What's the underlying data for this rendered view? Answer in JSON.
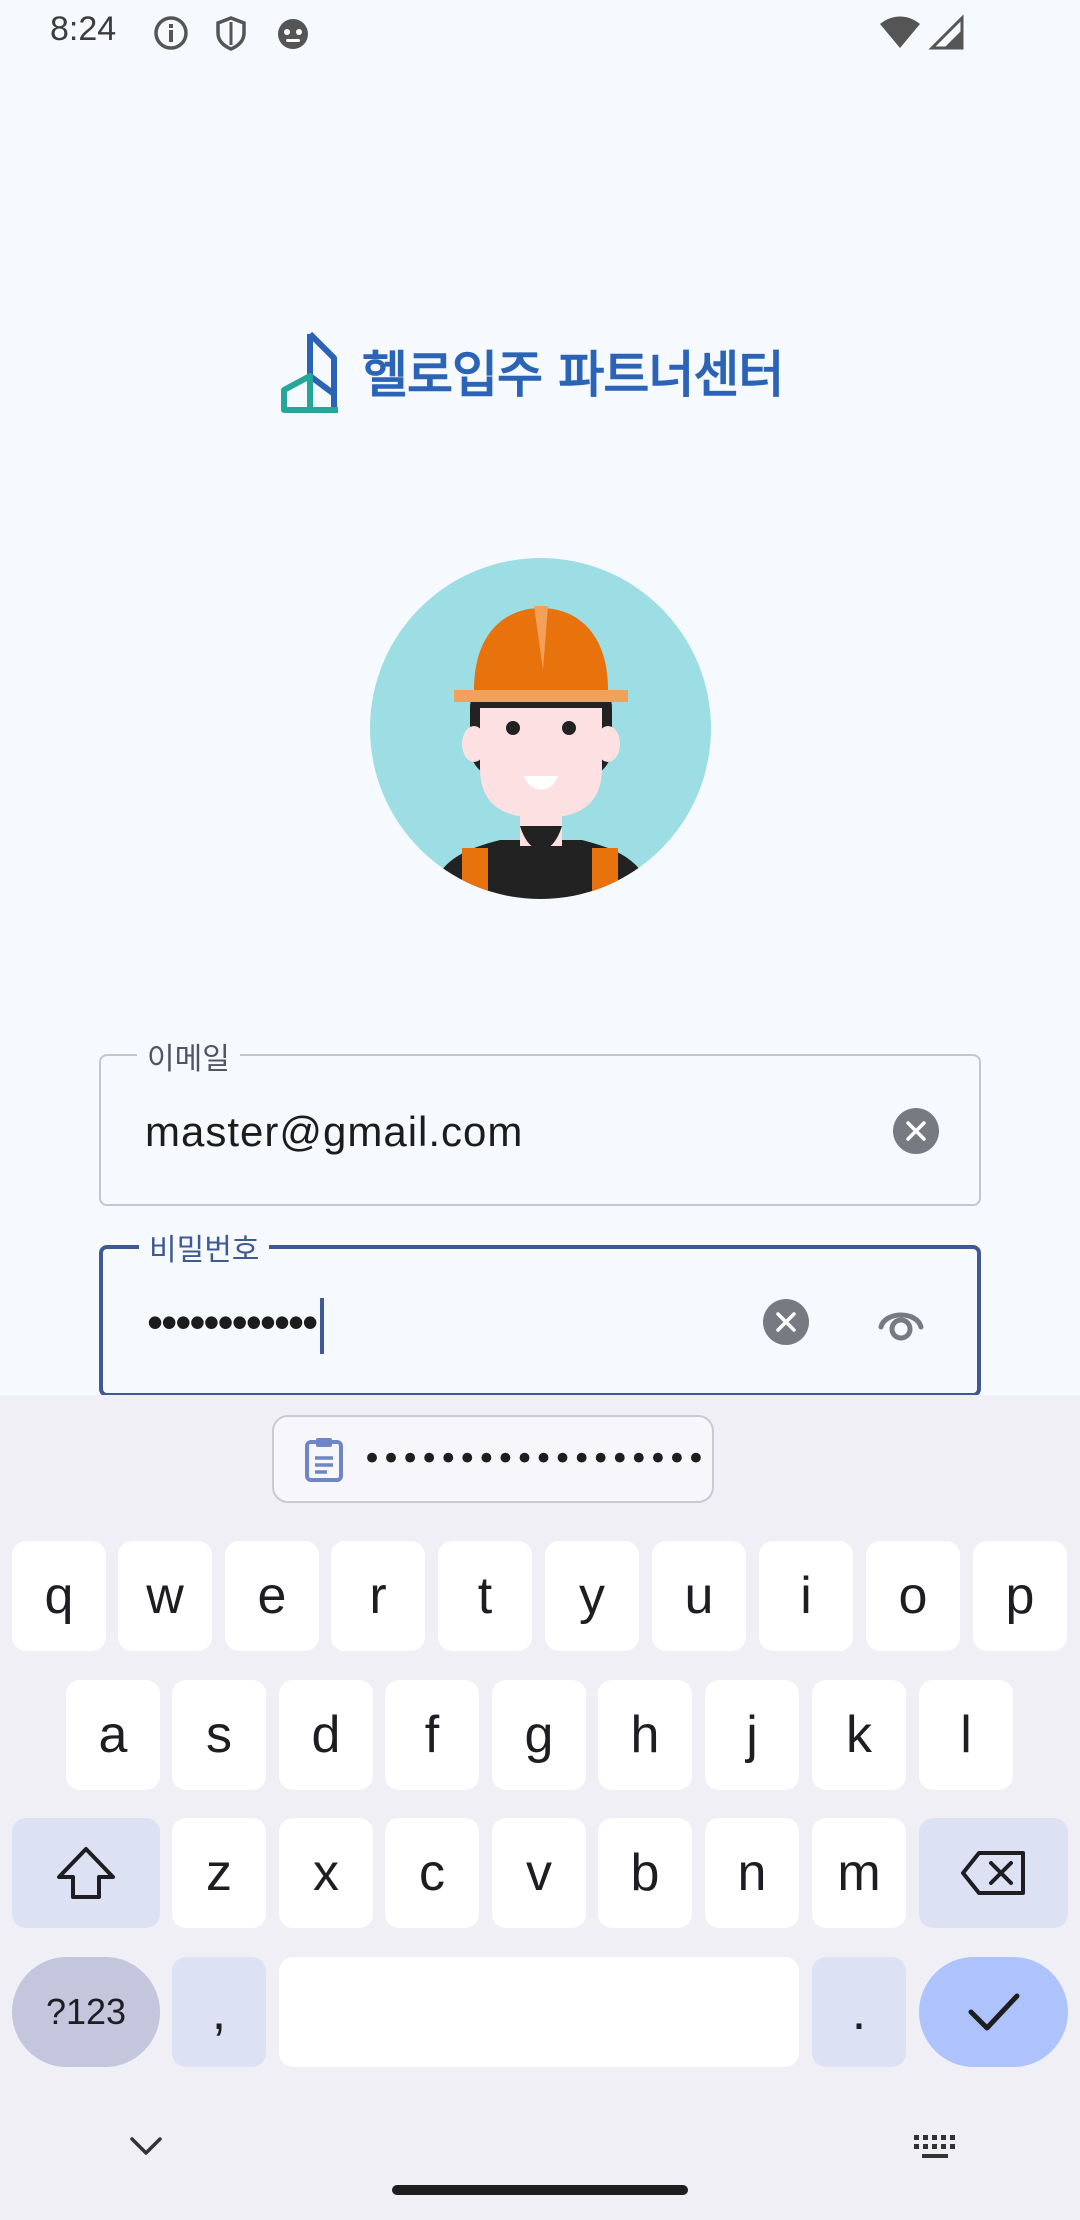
{
  "status_bar": {
    "time": "8:24",
    "icons": [
      "info-icon",
      "shield-icon",
      "robot-face-icon",
      "wifi-icon",
      "signal-icon"
    ]
  },
  "brand": {
    "name": "헬로입주 파트너센터",
    "color": "#2b64b7",
    "logo_colors": [
      "#2b64b7",
      "#26a69a"
    ]
  },
  "form": {
    "email": {
      "label": "이메일",
      "value": "master@gmail.com"
    },
    "password": {
      "label": "비밀번호",
      "value": "••••••••••••"
    }
  },
  "keyboard": {
    "clipboard_suggestion": "••••••••••••••••••",
    "rows": [
      [
        "q",
        "w",
        "e",
        "r",
        "t",
        "y",
        "u",
        "i",
        "o",
        "p"
      ],
      [
        "a",
        "s",
        "d",
        "f",
        "g",
        "h",
        "j",
        "k",
        "l"
      ],
      [
        "z",
        "x",
        "c",
        "v",
        "b",
        "n",
        "m"
      ]
    ],
    "symbols_label": "?123",
    "comma": ",",
    "period": ".",
    "accent_color": "#aec3fc"
  }
}
